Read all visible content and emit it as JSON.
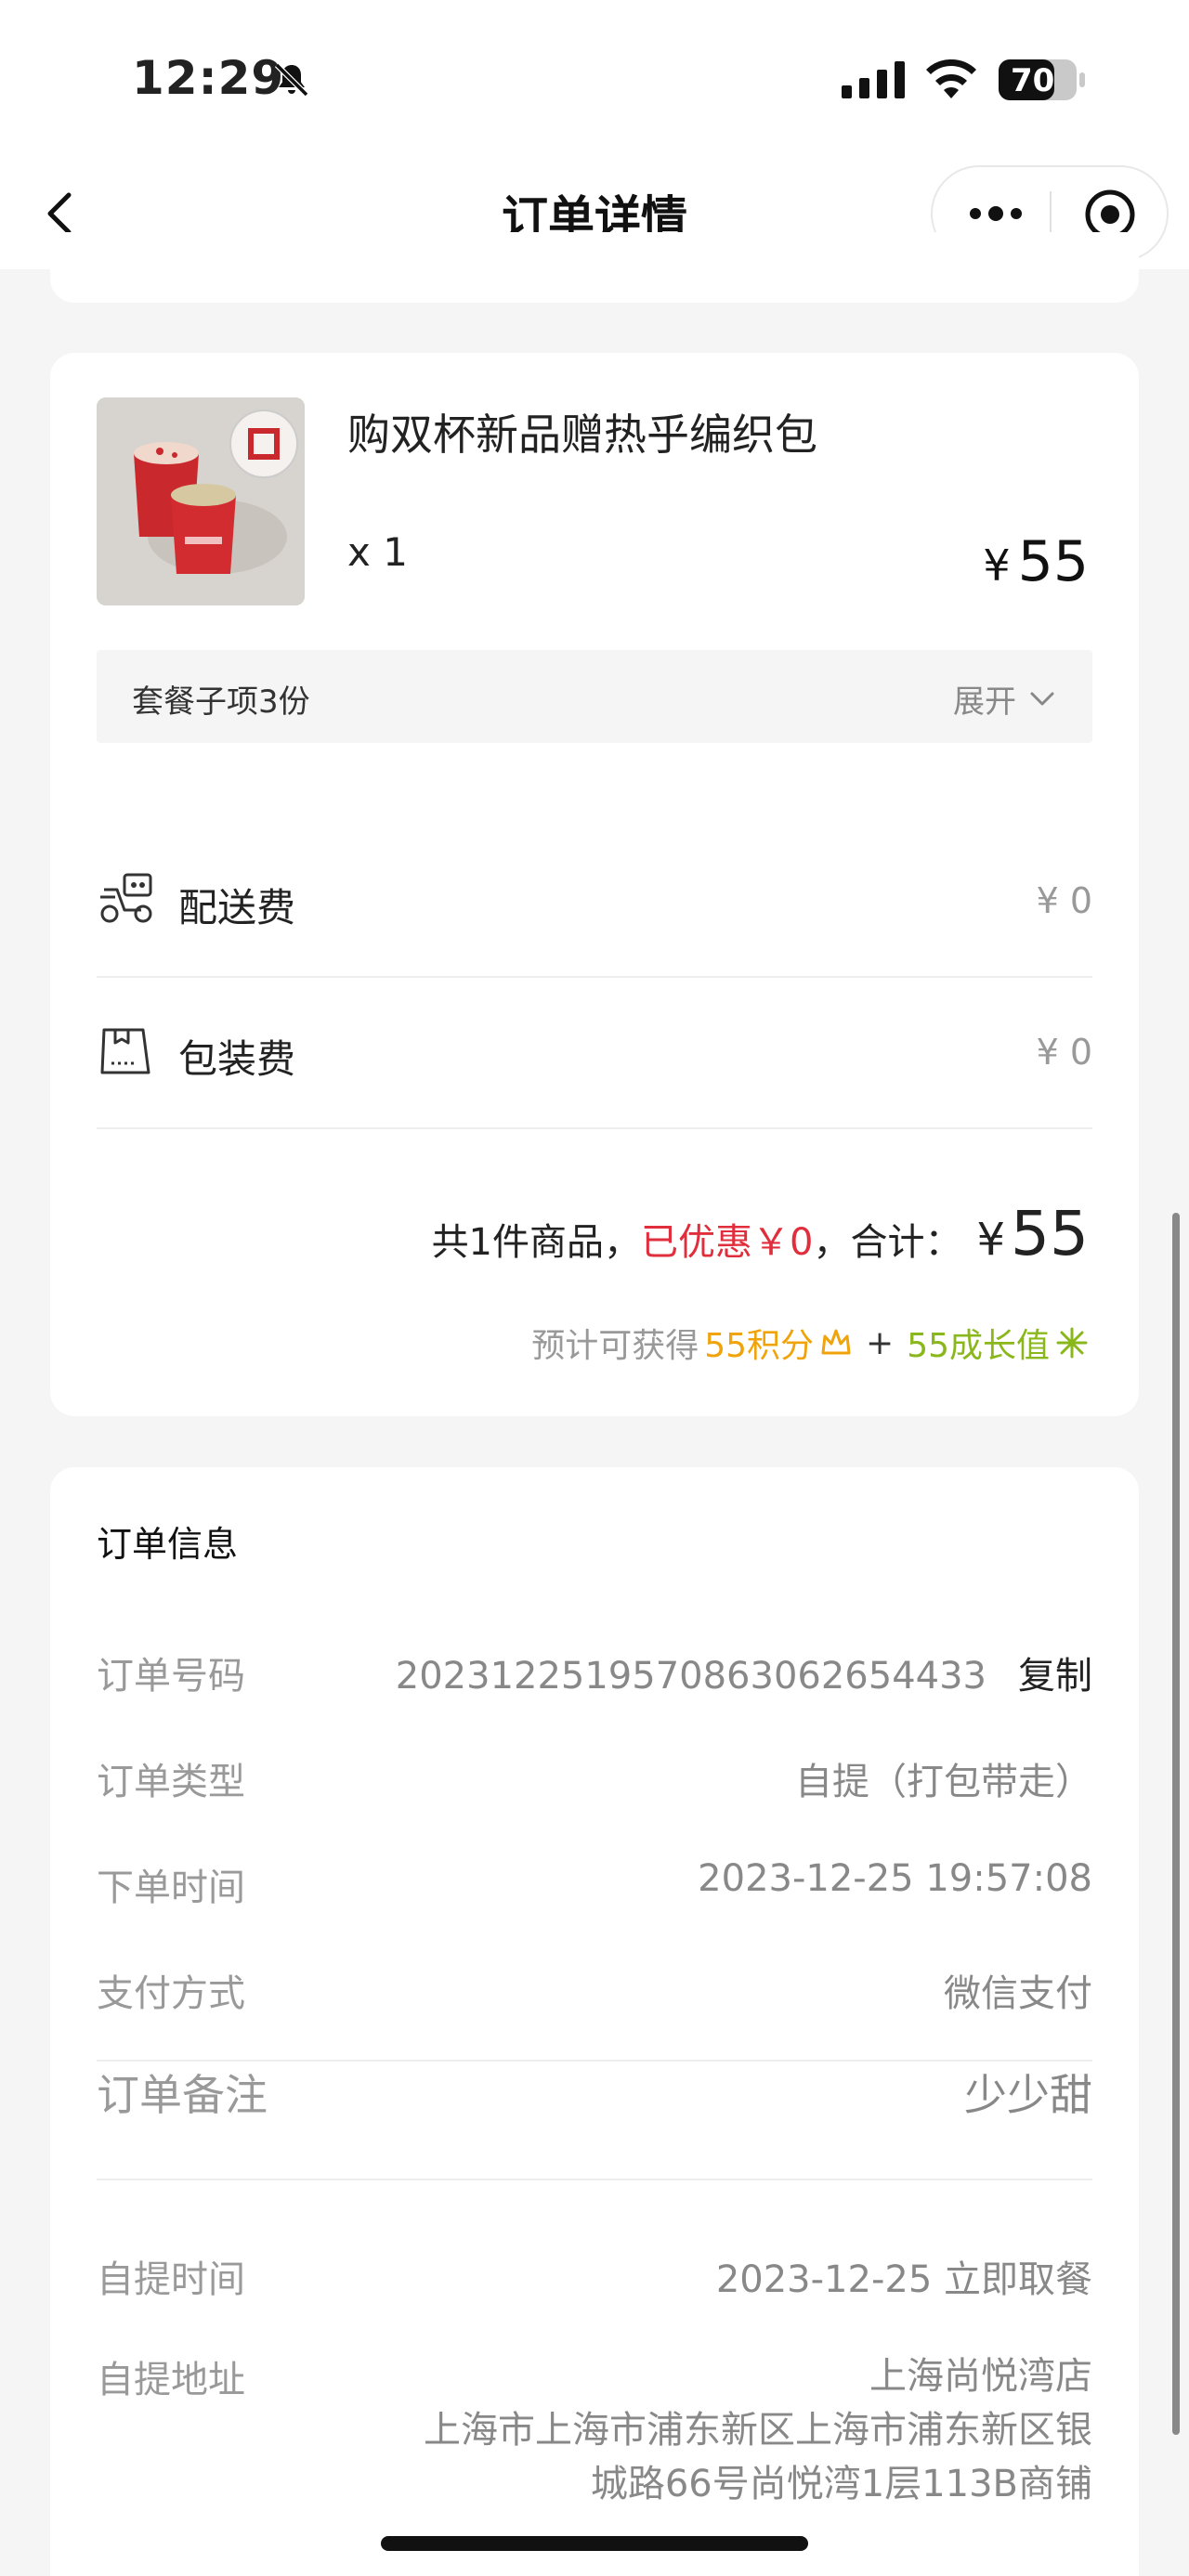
{
  "status_bar": {
    "time": "12:29",
    "battery": "70"
  },
  "nav": {
    "title": "订单详情"
  },
  "product": {
    "name": "购双杯新品赠热乎编织包",
    "qty": "x 1",
    "price_symbol": "¥",
    "price": "55",
    "combo_label": "套餐子项3份",
    "combo_toggle": "展开"
  },
  "fees": [
    {
      "label": "配送费",
      "value": "¥ 0",
      "icon": "scooter-icon"
    },
    {
      "label": "包装费",
      "value": "¥ 0",
      "icon": "bag-icon"
    }
  ],
  "summary": {
    "count_text": "共1件商品，",
    "discount_text": "已优惠￥0",
    "total_prefix": "，合计：",
    "total_symbol": "¥",
    "total_amount": "55",
    "points_prefix": "预计可获得",
    "points_text": "55积分",
    "plus": "+",
    "growth_text": "55成长值"
  },
  "order_info": {
    "title": "订单信息",
    "order_no_label": "订单号码",
    "order_no_value": "2023122519570863062654433",
    "copy_label": "复制",
    "type_label": "订单类型",
    "type_value": "自提（打包带走）",
    "time_label": "下单时间",
    "time_value": "2023-12-25 19:57:08",
    "pay_label": "支付方式",
    "pay_value": "微信支付",
    "remark_label": "订单备注",
    "remark_value": "少少甜",
    "pickup_time_label": "自提时间",
    "pickup_time_value": "2023-12-25 立即取餐",
    "pickup_addr_label": "自提地址",
    "pickup_store": "上海尚悦湾店",
    "pickup_addr_line1": "上海市上海市浦东新区上海市浦东新区银",
    "pickup_addr_line2": "城路66号尚悦湾1层113B商铺"
  },
  "colors": {
    "discount": "#e02e3c",
    "points": "#f0a30a",
    "growth": "#8ab81c"
  }
}
